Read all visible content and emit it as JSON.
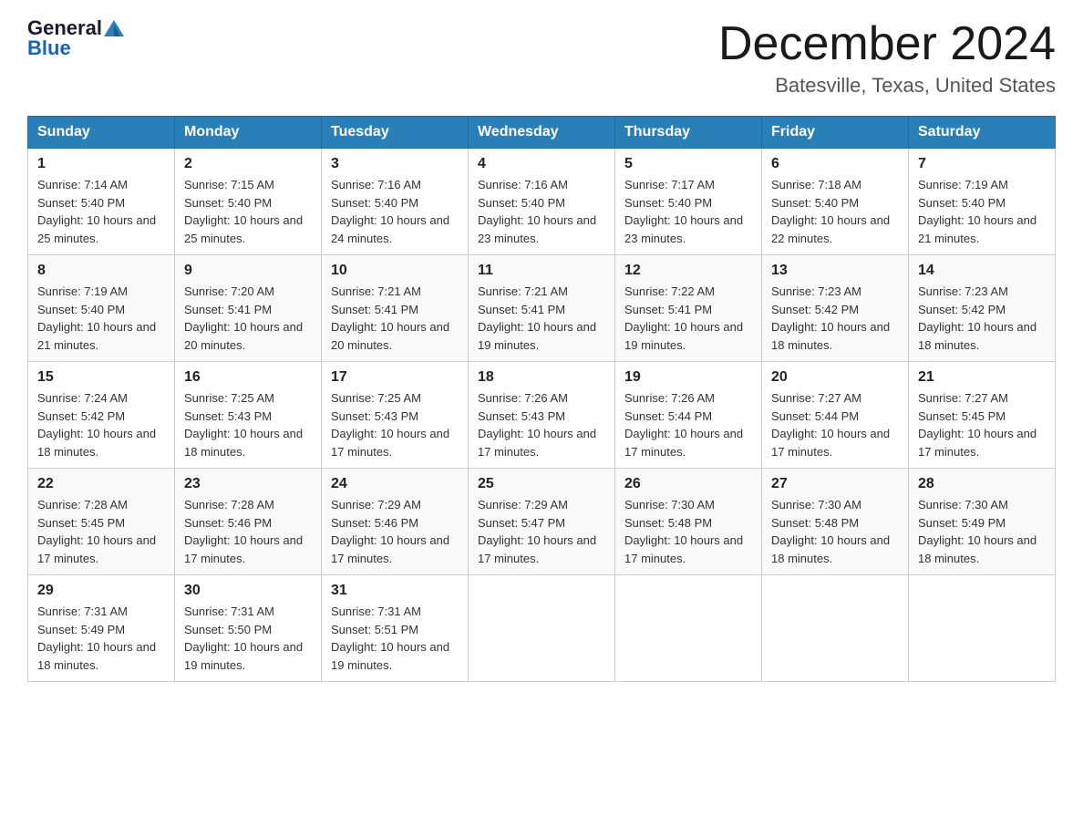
{
  "logo": {
    "general": "General",
    "blue": "Blue"
  },
  "title": "December 2024",
  "location": "Batesville, Texas, United States",
  "days_of_week": [
    "Sunday",
    "Monday",
    "Tuesday",
    "Wednesday",
    "Thursday",
    "Friday",
    "Saturday"
  ],
  "weeks": [
    [
      {
        "date": "1",
        "sunrise": "7:14 AM",
        "sunset": "5:40 PM",
        "daylight": "10 hours and 25 minutes."
      },
      {
        "date": "2",
        "sunrise": "7:15 AM",
        "sunset": "5:40 PM",
        "daylight": "10 hours and 25 minutes."
      },
      {
        "date": "3",
        "sunrise": "7:16 AM",
        "sunset": "5:40 PM",
        "daylight": "10 hours and 24 minutes."
      },
      {
        "date": "4",
        "sunrise": "7:16 AM",
        "sunset": "5:40 PM",
        "daylight": "10 hours and 23 minutes."
      },
      {
        "date": "5",
        "sunrise": "7:17 AM",
        "sunset": "5:40 PM",
        "daylight": "10 hours and 23 minutes."
      },
      {
        "date": "6",
        "sunrise": "7:18 AM",
        "sunset": "5:40 PM",
        "daylight": "10 hours and 22 minutes."
      },
      {
        "date": "7",
        "sunrise": "7:19 AM",
        "sunset": "5:40 PM",
        "daylight": "10 hours and 21 minutes."
      }
    ],
    [
      {
        "date": "8",
        "sunrise": "7:19 AM",
        "sunset": "5:40 PM",
        "daylight": "10 hours and 21 minutes."
      },
      {
        "date": "9",
        "sunrise": "7:20 AM",
        "sunset": "5:41 PM",
        "daylight": "10 hours and 20 minutes."
      },
      {
        "date": "10",
        "sunrise": "7:21 AM",
        "sunset": "5:41 PM",
        "daylight": "10 hours and 20 minutes."
      },
      {
        "date": "11",
        "sunrise": "7:21 AM",
        "sunset": "5:41 PM",
        "daylight": "10 hours and 19 minutes."
      },
      {
        "date": "12",
        "sunrise": "7:22 AM",
        "sunset": "5:41 PM",
        "daylight": "10 hours and 19 minutes."
      },
      {
        "date": "13",
        "sunrise": "7:23 AM",
        "sunset": "5:42 PM",
        "daylight": "10 hours and 18 minutes."
      },
      {
        "date": "14",
        "sunrise": "7:23 AM",
        "sunset": "5:42 PM",
        "daylight": "10 hours and 18 minutes."
      }
    ],
    [
      {
        "date": "15",
        "sunrise": "7:24 AM",
        "sunset": "5:42 PM",
        "daylight": "10 hours and 18 minutes."
      },
      {
        "date": "16",
        "sunrise": "7:25 AM",
        "sunset": "5:43 PM",
        "daylight": "10 hours and 18 minutes."
      },
      {
        "date": "17",
        "sunrise": "7:25 AM",
        "sunset": "5:43 PM",
        "daylight": "10 hours and 17 minutes."
      },
      {
        "date": "18",
        "sunrise": "7:26 AM",
        "sunset": "5:43 PM",
        "daylight": "10 hours and 17 minutes."
      },
      {
        "date": "19",
        "sunrise": "7:26 AM",
        "sunset": "5:44 PM",
        "daylight": "10 hours and 17 minutes."
      },
      {
        "date": "20",
        "sunrise": "7:27 AM",
        "sunset": "5:44 PM",
        "daylight": "10 hours and 17 minutes."
      },
      {
        "date": "21",
        "sunrise": "7:27 AM",
        "sunset": "5:45 PM",
        "daylight": "10 hours and 17 minutes."
      }
    ],
    [
      {
        "date": "22",
        "sunrise": "7:28 AM",
        "sunset": "5:45 PM",
        "daylight": "10 hours and 17 minutes."
      },
      {
        "date": "23",
        "sunrise": "7:28 AM",
        "sunset": "5:46 PM",
        "daylight": "10 hours and 17 minutes."
      },
      {
        "date": "24",
        "sunrise": "7:29 AM",
        "sunset": "5:46 PM",
        "daylight": "10 hours and 17 minutes."
      },
      {
        "date": "25",
        "sunrise": "7:29 AM",
        "sunset": "5:47 PM",
        "daylight": "10 hours and 17 minutes."
      },
      {
        "date": "26",
        "sunrise": "7:30 AM",
        "sunset": "5:48 PM",
        "daylight": "10 hours and 17 minutes."
      },
      {
        "date": "27",
        "sunrise": "7:30 AM",
        "sunset": "5:48 PM",
        "daylight": "10 hours and 18 minutes."
      },
      {
        "date": "28",
        "sunrise": "7:30 AM",
        "sunset": "5:49 PM",
        "daylight": "10 hours and 18 minutes."
      }
    ],
    [
      {
        "date": "29",
        "sunrise": "7:31 AM",
        "sunset": "5:49 PM",
        "daylight": "10 hours and 18 minutes."
      },
      {
        "date": "30",
        "sunrise": "7:31 AM",
        "sunset": "5:50 PM",
        "daylight": "10 hours and 19 minutes."
      },
      {
        "date": "31",
        "sunrise": "7:31 AM",
        "sunset": "5:51 PM",
        "daylight": "10 hours and 19 minutes."
      },
      null,
      null,
      null,
      null
    ]
  ],
  "labels": {
    "sunrise": "Sunrise:",
    "sunset": "Sunset:",
    "daylight": "Daylight:"
  }
}
